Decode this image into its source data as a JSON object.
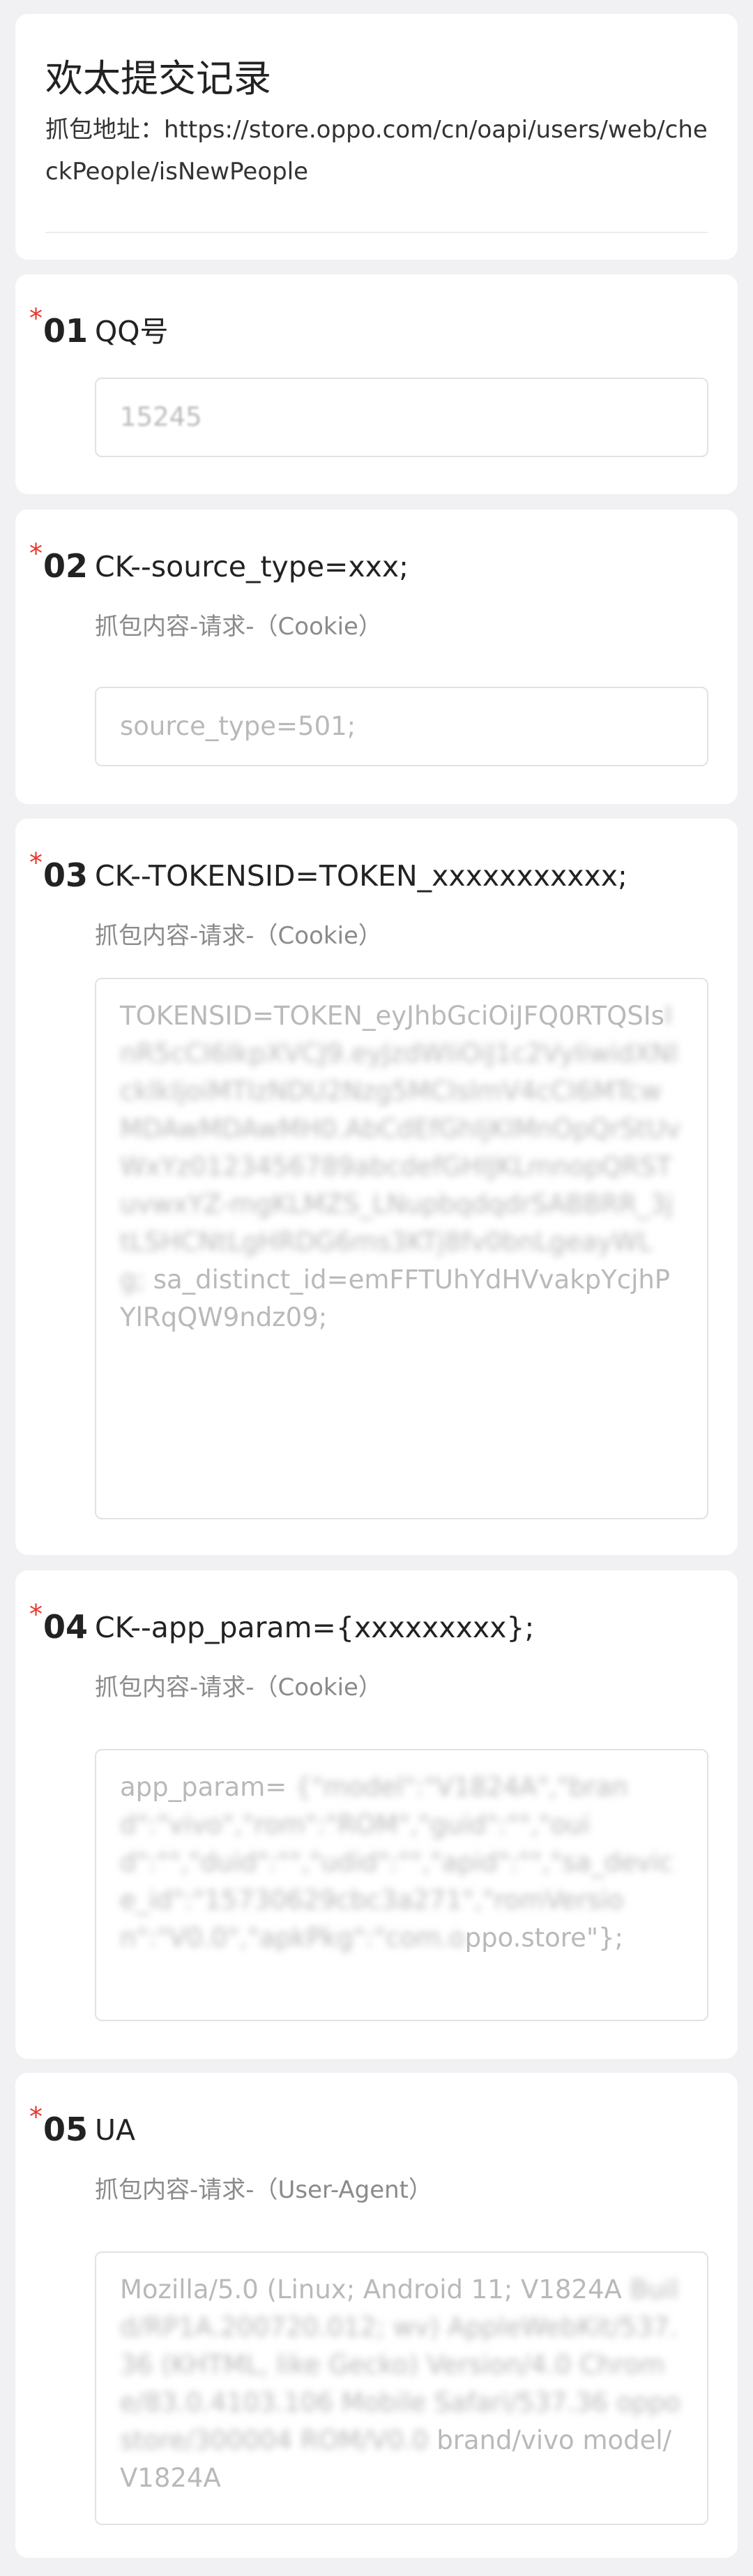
{
  "header": {
    "title": "欢太提交记录",
    "desc": "抓包地址：https://store.oppo.com/cn/oapi/users/web/checkPeople/isNewPeople"
  },
  "questions": [
    {
      "num": "01",
      "title": "QQ号",
      "value": "15245"
    },
    {
      "num": "02",
      "title": "CK--source_type=xxx;",
      "sub": "抓包内容-请求-（Cookie）",
      "value": "source_type=501;"
    },
    {
      "num": "03",
      "title": "CK--TOKENSID=TOKEN_xxxxxxxxxxx;",
      "sub": "抓包内容-请求-（Cookie）",
      "value_visible_start": "TOKENSID=TOKEN_eyJhbGciOiJFQ0RTQSIs",
      "value_blurred": "InR5cCI6IkpXVCJ9.eyJzdWIiOiJ1c2VyIiwidXNlcklkIjoiMTIzNDU2Nzg5MCIsImV4cCI6MTcwMDAwMDAwMH0.AbCdEfGhIjKlMnOpQrStUvWxYz0123456789abcdefGHIJKLmnopQRSTuvwxYZ-mgKLMZS_LNupbqdqdrSABBRR_3jtLSHCNtLgHRDG6ms3KTj8fv0bnLgeayWL g;",
      "value_visible_end": "sa_distinct_id=emFFTUhYdHVvakpYcjhPYlRqQW9ndz09;"
    },
    {
      "num": "04",
      "title": "CK--app_param={xxxxxxxxx};",
      "sub": "抓包内容-请求-（Cookie）",
      "value_visible_start": "app_param=",
      "value_blurred": "{\"model\":\"V1824A\",\"brand\":\"vivo\",\"rom\":\"ROM\",\"guid\":\"\",\"ouid\":\"\",\"duid\":\"\",\"udid\":\"\",\"apid\":\"\",\"sa_device_id\":\"15730629cbc3a271\",\"romVersion\":\"V0.0\",\"apkPkg\":\"com.o",
      "value_visible_end": "ppo.store\"};"
    },
    {
      "num": "05",
      "title": "UA",
      "sub": "抓包内容-请求-（User-Agent）",
      "value_visible_start": "Mozilla/5.0 (Linux; Android 11; V1824A",
      "value_blurred": "Build/RP1A.200720.012; wv) AppleWebKit/537.36 (KHTML, like Gecko) Version/4.0 Chrome/83.0.4103.106 Mobile Safari/537.36 oppostore/300004 ROM/V0.0",
      "value_visible_end": "brand/vivo model/V1824A"
    }
  ],
  "colors": {
    "page_bg": "#f1f1f3",
    "card_bg": "#ffffff",
    "required_star": "#e8352c",
    "placeholder_text": "#b9b9b9"
  }
}
